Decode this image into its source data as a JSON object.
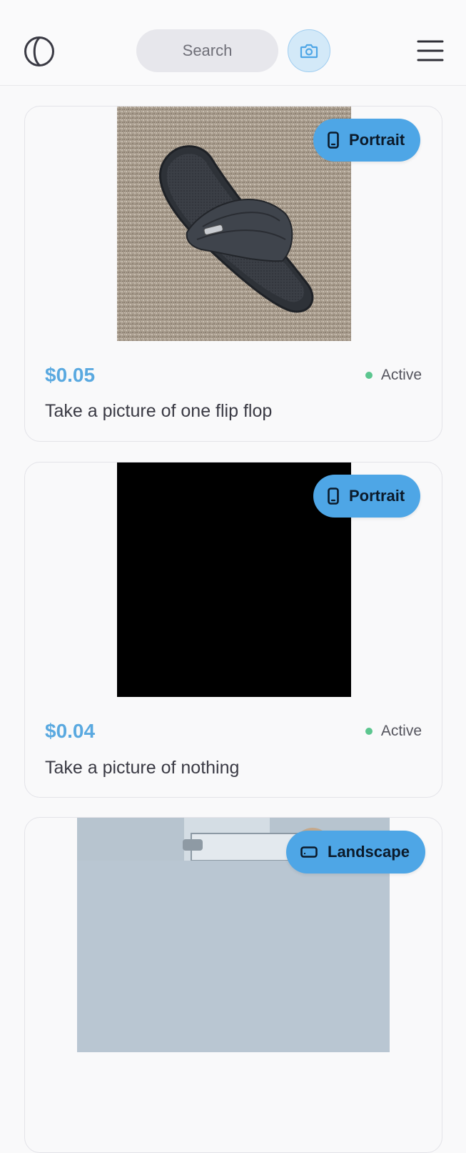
{
  "header": {
    "logo_icon": "circle-half-logo-icon",
    "search_placeholder": "Search",
    "camera_icon": "camera-icon",
    "menu_icon": "hamburger-menu-icon"
  },
  "colors": {
    "accent": "#4ea6e6",
    "price": "#5aa9e0",
    "active_dot": "#5cc68f"
  },
  "cards": [
    {
      "orientation_label": "Portrait",
      "orientation_icon": "phone-portrait-icon",
      "price": "$0.05",
      "status": "Active",
      "description": "Take a picture of one flip flop",
      "image": "flip-flop-photo"
    },
    {
      "orientation_label": "Portrait",
      "orientation_icon": "phone-portrait-icon",
      "price": "$0.04",
      "status": "Active",
      "description": "Take a picture of nothing",
      "image": "black-photo"
    },
    {
      "orientation_label": "Landscape",
      "orientation_icon": "phone-landscape-icon",
      "image": "glass-box-photo"
    }
  ]
}
